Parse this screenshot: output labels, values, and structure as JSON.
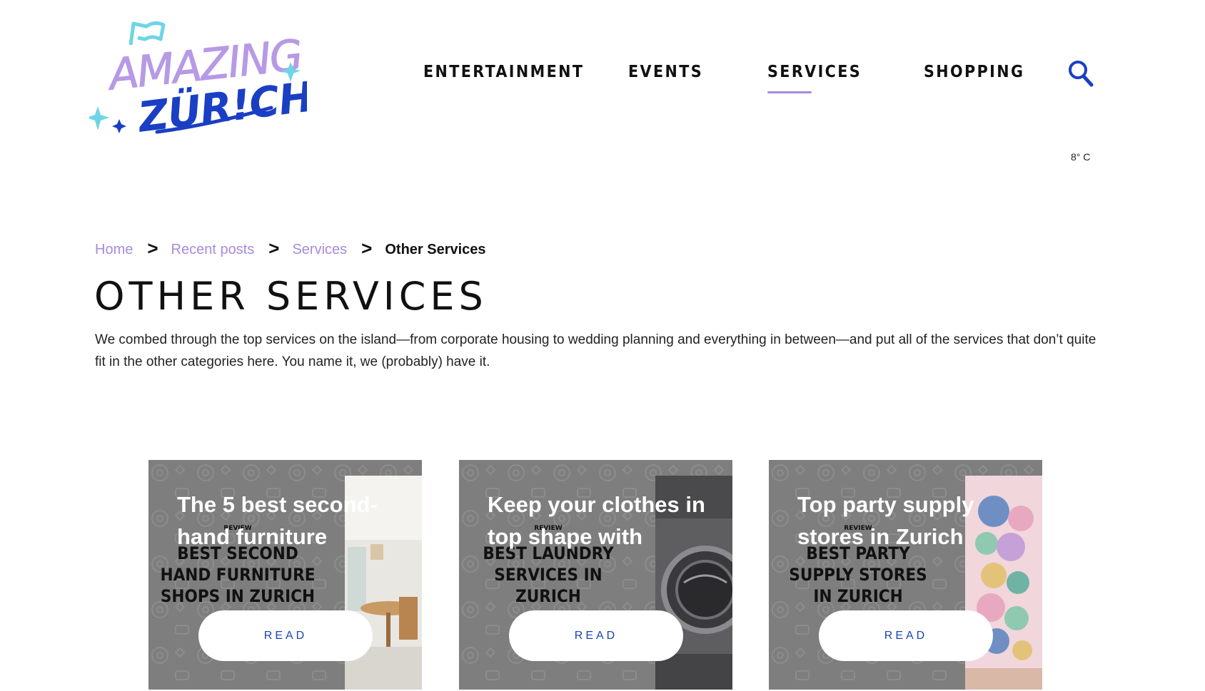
{
  "header": {
    "logo": {
      "alt": "Amazing Zurich",
      "line1": "AMAZING",
      "line2": "ZÜR!CH"
    },
    "nav": [
      {
        "label": "ENTERTAINMENT",
        "active": false
      },
      {
        "label": "EVENTS",
        "active": false
      },
      {
        "label": "SERVICES",
        "active": true
      },
      {
        "label": "SHOPPING",
        "active": false
      }
    ],
    "search_icon": "search-icon",
    "weather": "8° C"
  },
  "breadcrumb": {
    "items": [
      "Home",
      "Recent posts",
      "Services"
    ],
    "separator": ">",
    "current": "Other Services"
  },
  "page": {
    "title": "OTHER SERVICES",
    "intro": "We combed through the top services on the island—from corporate housing to wedding planning and everything in between—and put all of the services that don’t quite fit in the other categories here. You name it, we (probably) have it."
  },
  "cards": [
    {
      "title": "The 5 best second-hand furniture",
      "label": "REVIEW",
      "promo_lines": [
        "BEST SECOND",
        "HAND FURNITURE",
        "SHOPS IN ZURICH"
      ],
      "button": "READ",
      "photo": "furniture-room-photo"
    },
    {
      "title": "Keep your clothes in top shape with",
      "label": "REVIEW",
      "promo_lines": [
        "BEST LAUNDRY",
        "SERVICES IN",
        "ZURICH"
      ],
      "button": "READ",
      "photo": "washing-machine-photo"
    },
    {
      "title": "Top party supply stores in Zurich",
      "label": "REVIEW",
      "promo_lines": [
        "BEST PARTY",
        "SUPPLY STORES",
        "IN ZURICH"
      ],
      "button": "READ",
      "photo": "balloon-arch-photo"
    }
  ],
  "colors": {
    "accent_lavender": "#a78bdd",
    "brand_blue": "#1a3fc4",
    "card_grey": "#7e7e7e",
    "button_text": "#1a45b0"
  }
}
